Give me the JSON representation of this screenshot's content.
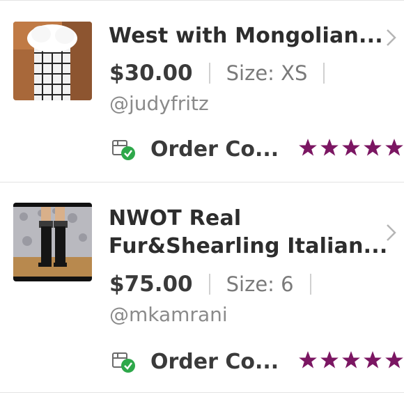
{
  "items": [
    {
      "title_line1": "West with Mongolian...",
      "title_line2": "",
      "price": "$30.00",
      "size": "Size: XS",
      "seller": "@judyfritz",
      "status": "Order Co...",
      "rating": 5,
      "thumb_icon": "fur-vest-photo"
    },
    {
      "title_line1": "NWOT Real",
      "title_line2": "Fur&Shearling Italian...",
      "price": "$75.00",
      "size": "Size: 6",
      "seller": "@mkamrani",
      "status": "Order Co...",
      "rating": 5,
      "thumb_icon": "boots-photo"
    }
  ],
  "colors": {
    "star": "#7b1662",
    "check": "#2ea84a",
    "divider": "#e3e3e3"
  }
}
